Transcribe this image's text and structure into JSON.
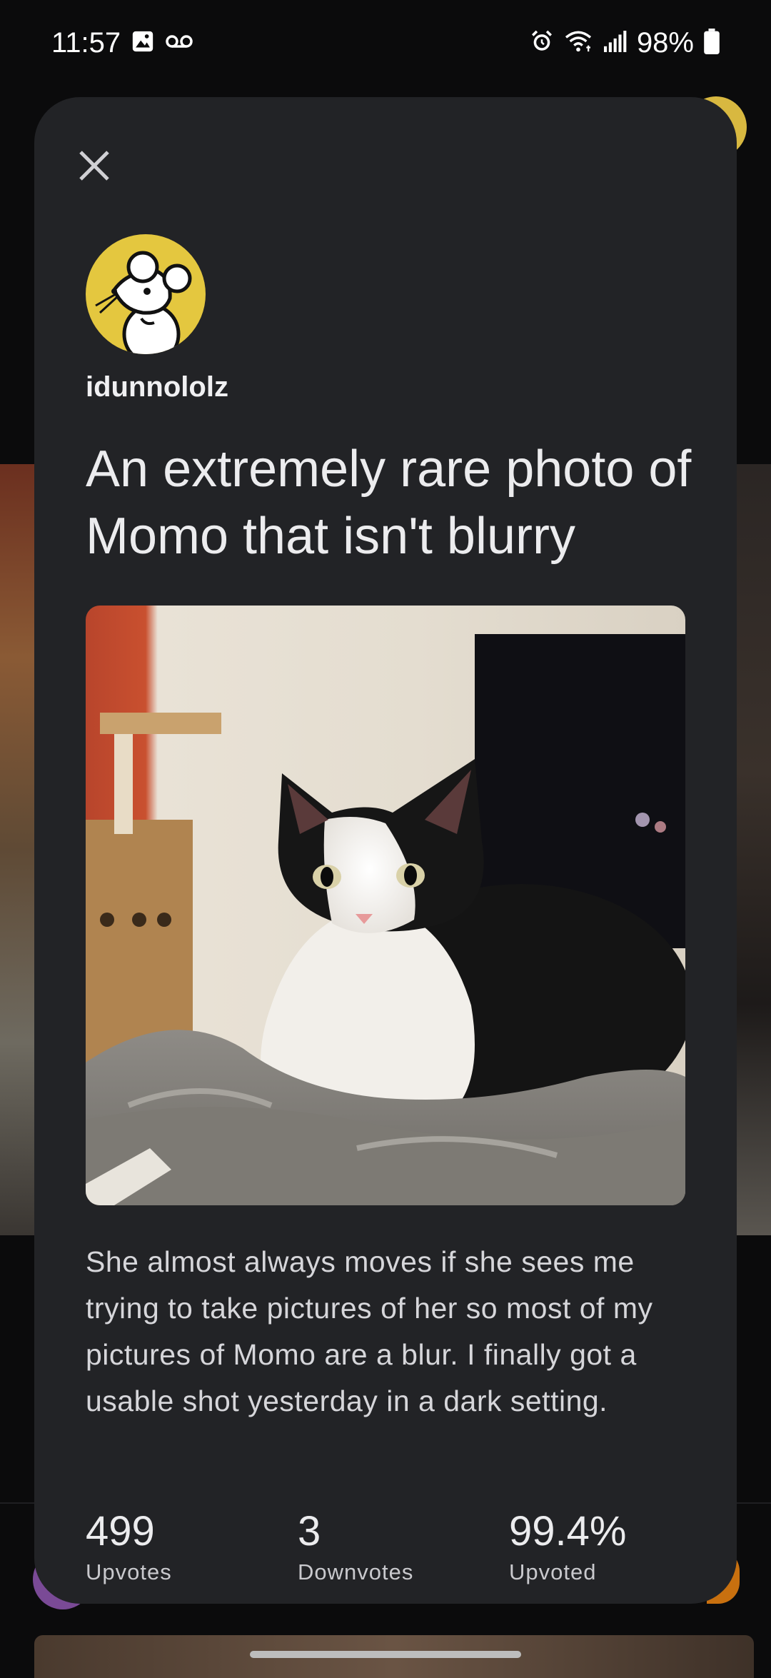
{
  "status_bar": {
    "time": "11:57",
    "battery": "98%",
    "left_icons": [
      "gallery-icon",
      "voicemail-icon"
    ],
    "right_icons": [
      "alarm-icon",
      "wifi-icon",
      "signal-icon",
      "battery-icon"
    ]
  },
  "post": {
    "username": "idunnololz",
    "title": "An extremely rare photo of Momo that isn't blurry",
    "body": "She almost always moves if she sees me trying to take pictures of her so most of my pictures of Momo are a blur. I finally got a usable shot yesterday in a dark setting.",
    "image_alt": "Black and white cat lying on a grey blanket"
  },
  "stats": [
    {
      "value": "499",
      "label": "Upvotes"
    },
    {
      "value": "3",
      "label": "Downvotes"
    },
    {
      "value": "99.4%",
      "label": "Upvoted"
    }
  ],
  "colors": {
    "card_bg": "#222326",
    "avatar_bg": "#e4c73f",
    "page_bg": "#0b0b0c"
  }
}
